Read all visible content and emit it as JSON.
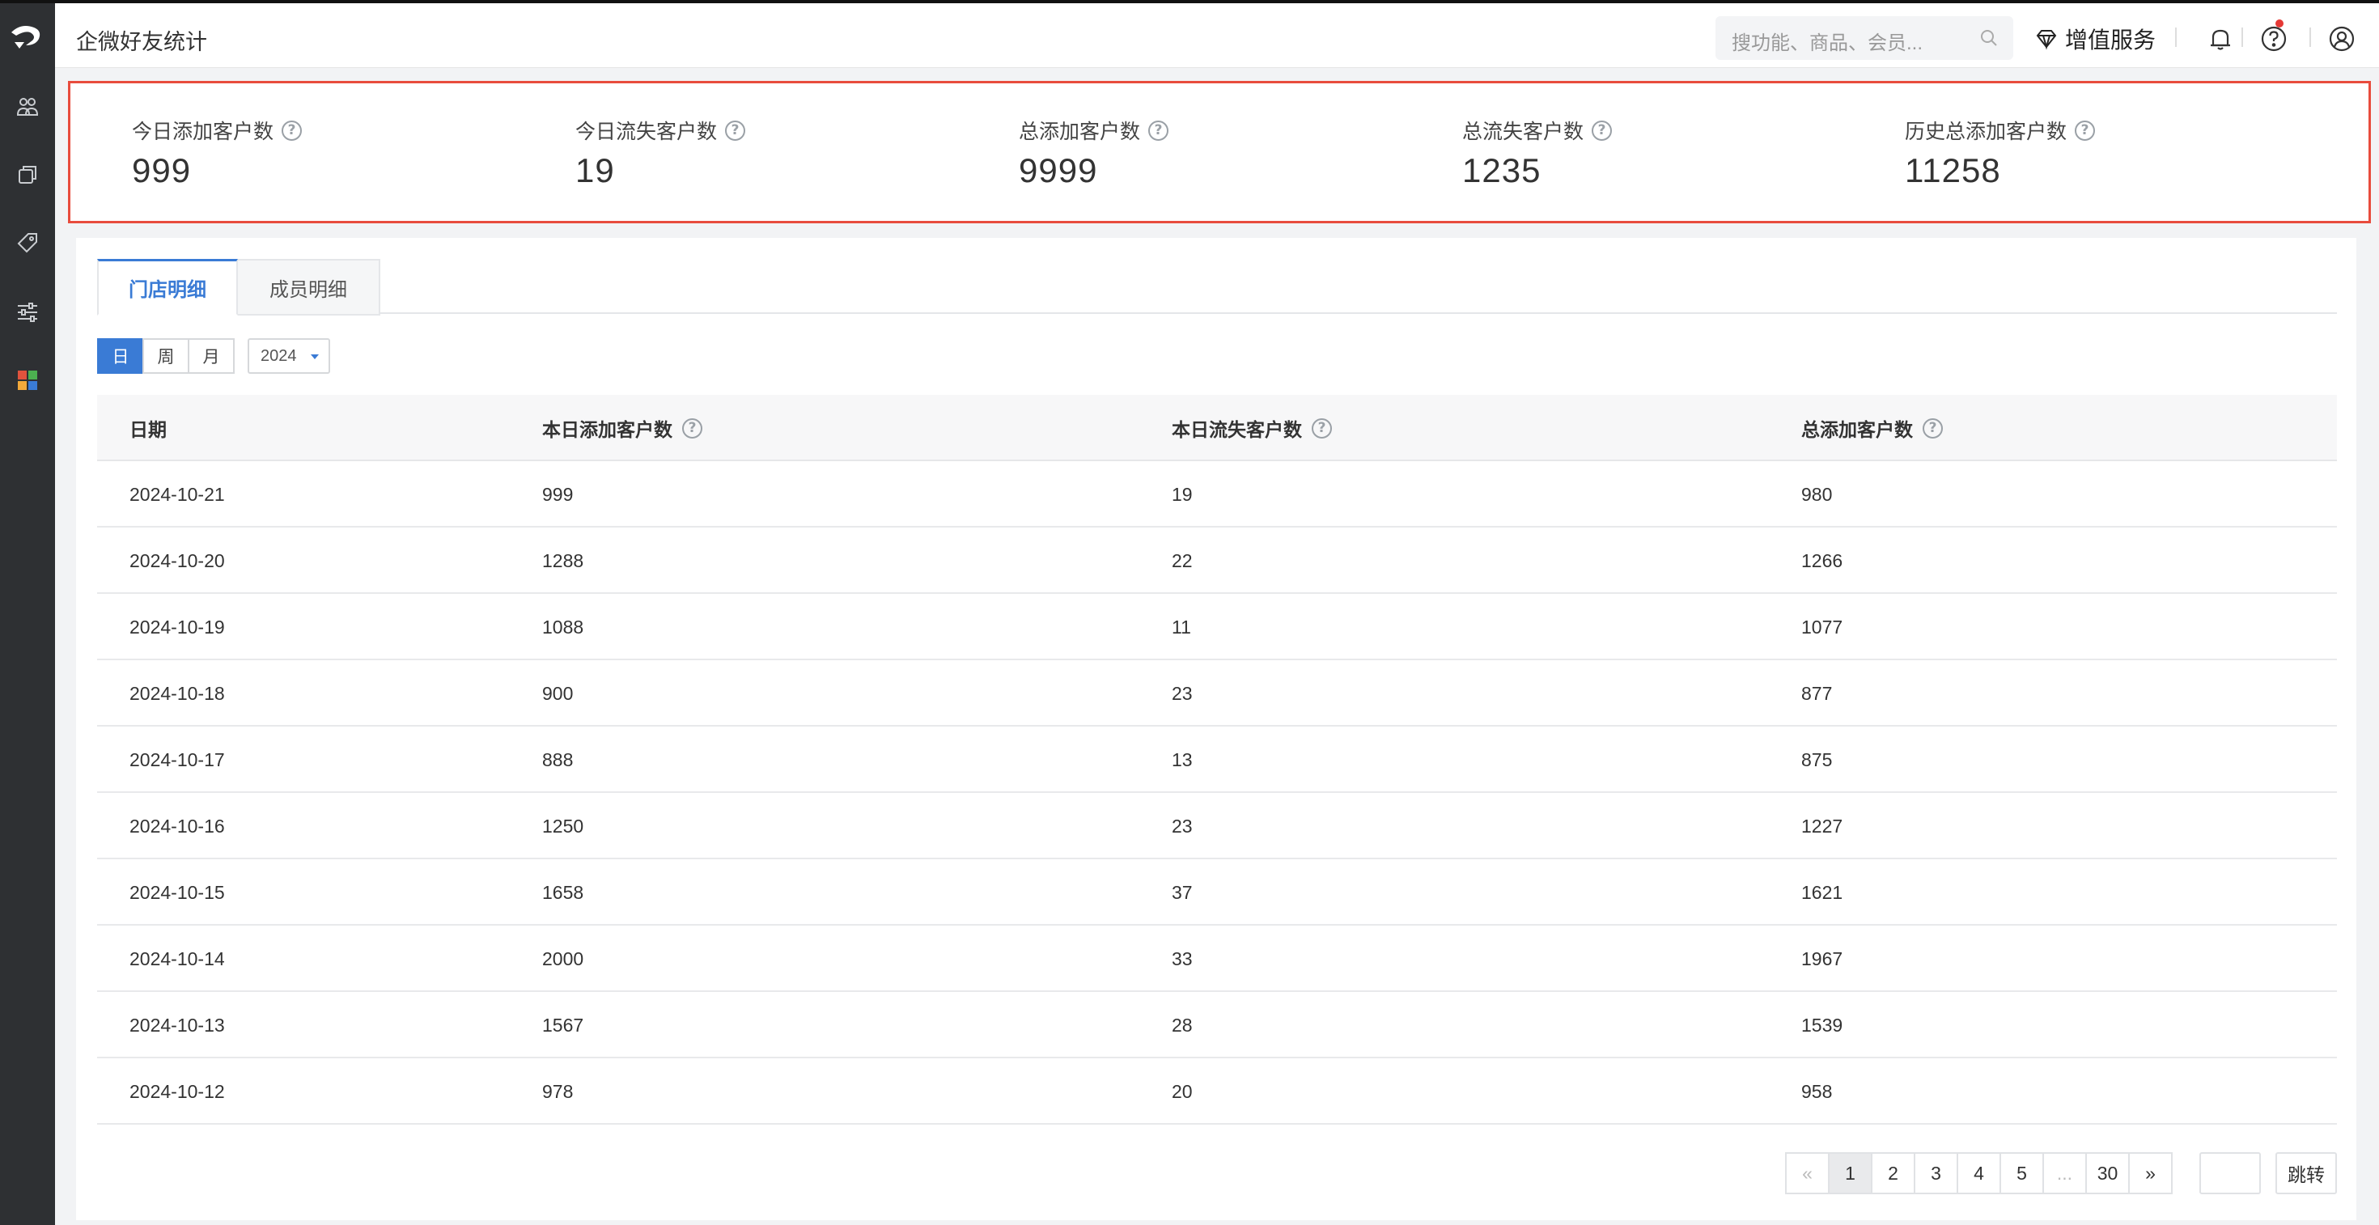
{
  "sidebar": {
    "logo": "brand-logo",
    "items": [
      {
        "icon": "customers-icon"
      },
      {
        "icon": "copy-icon"
      },
      {
        "icon": "tag-icon"
      },
      {
        "icon": "sliders-icon"
      },
      {
        "icon": "apps-icon"
      }
    ]
  },
  "header": {
    "title": "企微好友统计",
    "search_placeholder": "搜功能、商品、会员...",
    "value_service": "增值服务"
  },
  "stats": [
    {
      "label": "今日添加客户数",
      "value": "999"
    },
    {
      "label": "今日流失客户数",
      "value": "19"
    },
    {
      "label": "总添加客户数",
      "value": "9999"
    },
    {
      "label": "总流失客户数",
      "value": "1235"
    },
    {
      "label": "历史总添加客户数",
      "value": "11258"
    }
  ],
  "tabs": [
    {
      "label": "门店明细",
      "active": true
    },
    {
      "label": "成员明细",
      "active": false
    }
  ],
  "periods": {
    "day": "日",
    "week": "周",
    "month": "月",
    "selected": "日",
    "year": "2024"
  },
  "table": {
    "columns": [
      "日期",
      "本日添加客户数",
      "本日流失客户数",
      "总添加客户数"
    ],
    "rows": [
      [
        "2024-10-21",
        "999",
        "19",
        "980"
      ],
      [
        "2024-10-20",
        "1288",
        "22",
        "1266"
      ],
      [
        "2024-10-19",
        "1088",
        "11",
        "1077"
      ],
      [
        "2024-10-18",
        "900",
        "23",
        "877"
      ],
      [
        "2024-10-17",
        "888",
        "13",
        "875"
      ],
      [
        "2024-10-16",
        "1250",
        "23",
        "1227"
      ],
      [
        "2024-10-15",
        "1658",
        "37",
        "1621"
      ],
      [
        "2024-10-14",
        "2000",
        "33",
        "1967"
      ],
      [
        "2024-10-13",
        "1567",
        "28",
        "1539"
      ],
      [
        "2024-10-12",
        "978",
        "20",
        "958"
      ]
    ]
  },
  "pagination": {
    "prev": "«",
    "pages": [
      "1",
      "2",
      "3",
      "4",
      "5"
    ],
    "ellipsis": "...",
    "last": "30",
    "next": "»",
    "current": "1",
    "jump_label": "跳转"
  },
  "colors": {
    "accent": "#3a7bd5",
    "highlight_border": "#e84c3d",
    "sidebar_bg": "#2e3033"
  }
}
